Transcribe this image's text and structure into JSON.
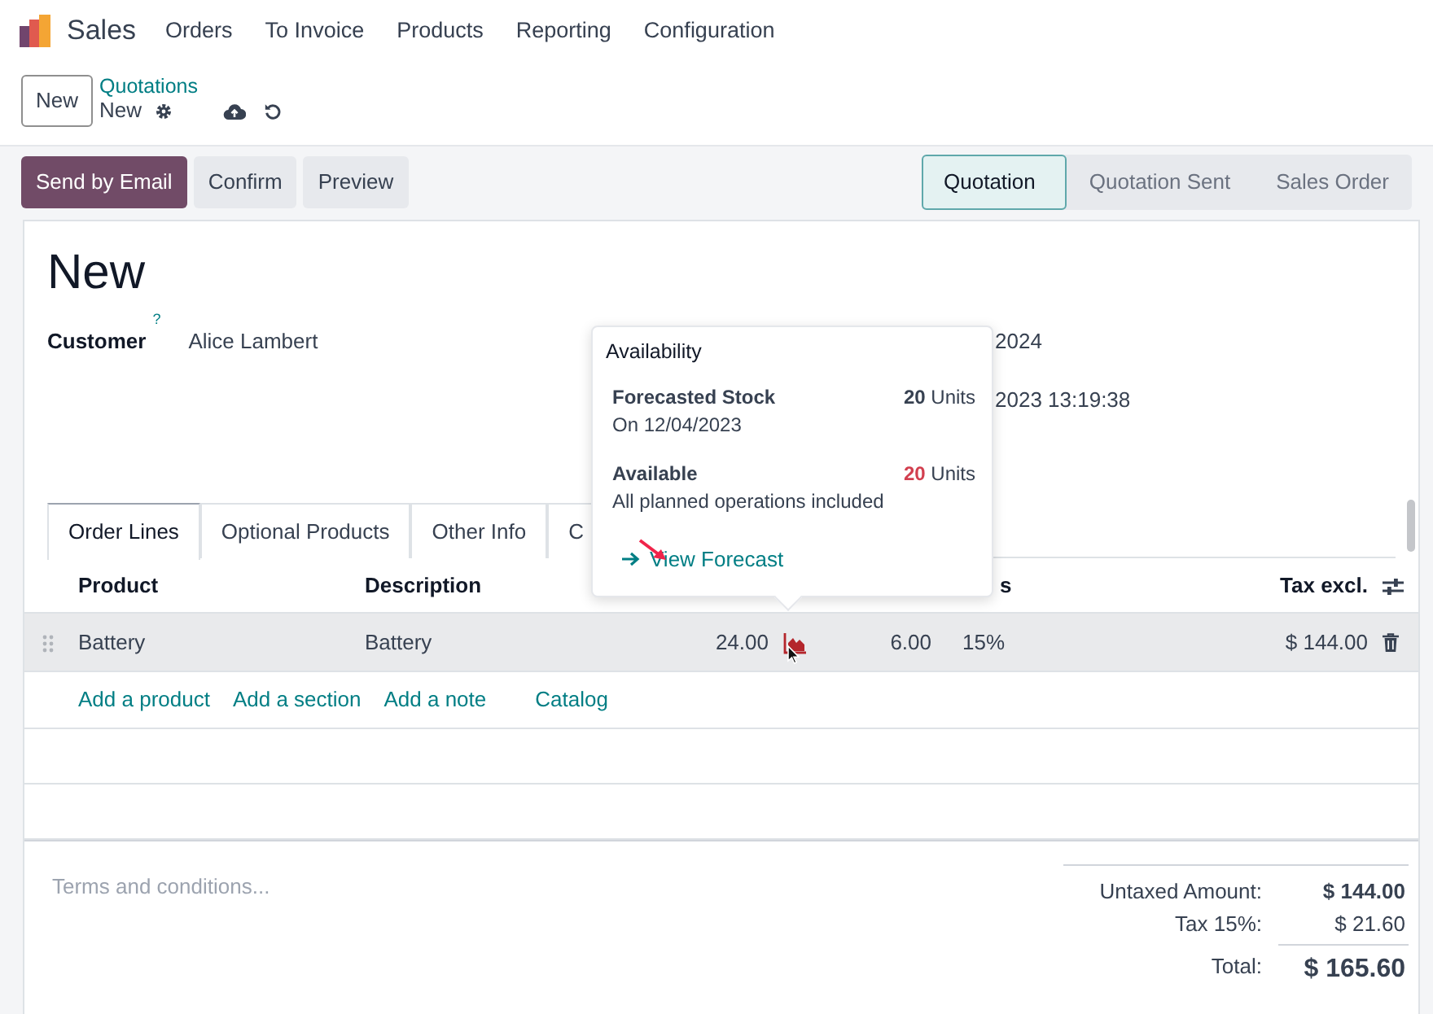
{
  "app": {
    "name": "Sales"
  },
  "menu": [
    "Orders",
    "To Invoice",
    "Products",
    "Reporting",
    "Configuration"
  ],
  "control_panel": {
    "new_button": "New",
    "breadcrumb": "Quotations",
    "record": "New"
  },
  "actions": [
    {
      "label": "Send by Email",
      "kind": "primary"
    },
    {
      "label": "Confirm",
      "kind": "secondary"
    },
    {
      "label": "Preview",
      "kind": "secondary"
    }
  ],
  "stages": [
    {
      "label": "Quotation",
      "selected": true
    },
    {
      "label": "Quotation Sent",
      "selected": false
    },
    {
      "label": "Sales Order",
      "selected": false
    }
  ],
  "form": {
    "title": "New",
    "fields": [
      {
        "label": "Customer",
        "help": "?",
        "value": "Alice Lambert"
      }
    ],
    "right_fields": [
      "2024",
      "2023 13:19:38"
    ]
  },
  "tabs": [
    {
      "label": "Order Lines",
      "selected": true
    },
    {
      "label": "Optional Products",
      "selected": false
    },
    {
      "label": "Other Info",
      "selected": false
    },
    {
      "label": "C",
      "selected": false
    }
  ],
  "table": {
    "columns": [
      "Product",
      "Description",
      "s",
      "Tax excl."
    ],
    "rows": [
      {
        "product": "Battery",
        "description": "Battery",
        "quantity": "24.00",
        "unit_price": "6.00",
        "taxes": "15%",
        "subtotal": "$ 144.00",
        "selected": true
      }
    ],
    "add_links": [
      "Add a product",
      "Add a section",
      "Add a note",
      "Catalog"
    ]
  },
  "terms": {
    "placeholder": "Terms and conditions..."
  },
  "totals": [
    {
      "label": "Untaxed Amount:",
      "value": "$ 144.00",
      "kind": "bold"
    },
    {
      "label": "Tax 15%:",
      "value": "$ 21.60",
      "kind": "plain"
    },
    {
      "label": "Total:",
      "value": "$ 165.60",
      "kind": "grand"
    }
  ],
  "popover": {
    "title": "Availability",
    "sections": [
      {
        "title": "Forecasted Stock",
        "quantity": "20",
        "unit": "Units",
        "note": "On 12/04/2023",
        "color": "#374151"
      },
      {
        "title": "Available",
        "quantity": "20",
        "unit": "Units",
        "note": "All planned operations included",
        "color": "#d23f4f"
      }
    ],
    "link": "View Forecast"
  }
}
